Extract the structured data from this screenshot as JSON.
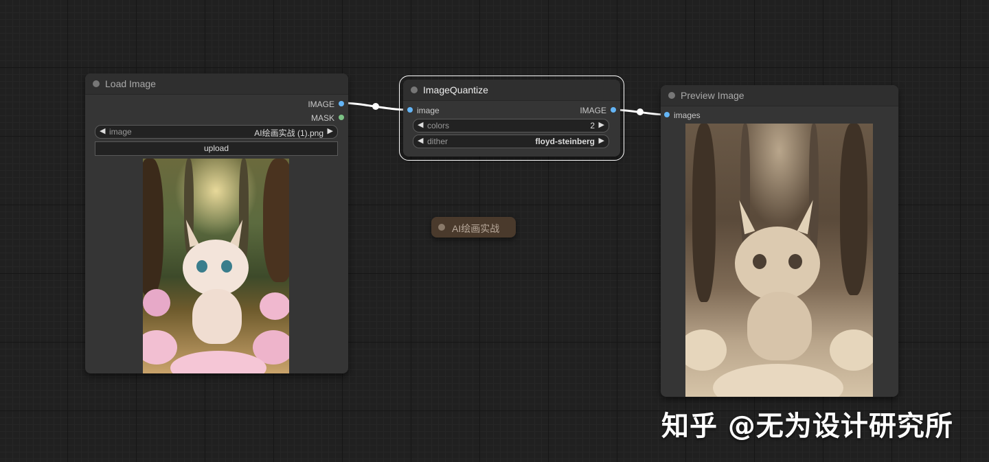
{
  "nodes": {
    "load_image": {
      "title": "Load Image",
      "outputs": [
        "IMAGE",
        "MASK"
      ],
      "widget_image": {
        "name": "image",
        "value": "AI绘画实战 (1).png"
      },
      "upload_label": "upload"
    },
    "image_quantize": {
      "title": "ImageQuantize",
      "input": "image",
      "output": "IMAGE",
      "widget_colors": {
        "name": "colors",
        "value": "2"
      },
      "widget_dither": {
        "name": "dither",
        "value": "floyd-steinberg"
      }
    },
    "preview_image": {
      "title": "Preview Image",
      "input": "images"
    }
  },
  "group_note": {
    "title": "AI绘画实战"
  },
  "watermark": {
    "text": "知乎 @无为设计研究所"
  },
  "arrows": {
    "left": "◀",
    "right": "▶"
  },
  "colors": {
    "canvas": "#202020",
    "node_bg": "#353535",
    "image_slot": "#64b5f6",
    "mask_slot": "#7cc285",
    "selected_outline": "#ffffff",
    "note_bg": "#4a3a2c"
  }
}
